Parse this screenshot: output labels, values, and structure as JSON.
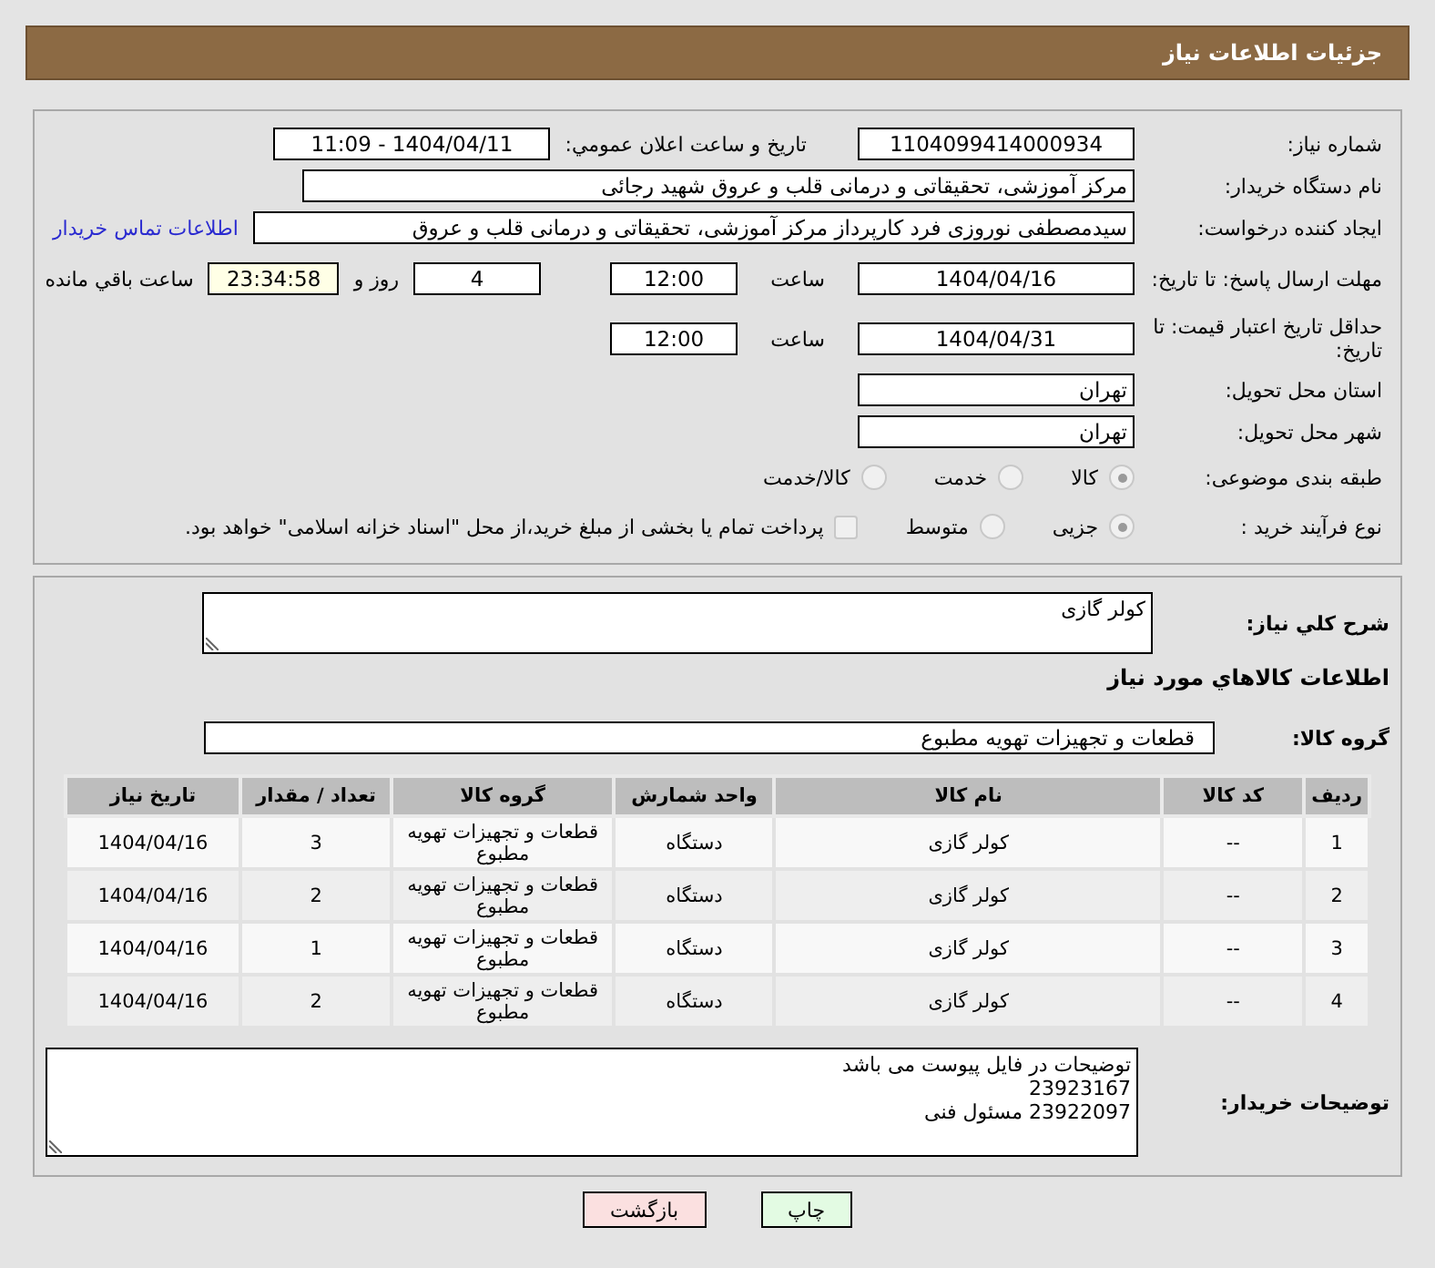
{
  "header": {
    "title": "جزئیات اطلاعات نیاز"
  },
  "need_number": {
    "label": "شماره نیاز:",
    "value": "1104099414000934"
  },
  "announce": {
    "label": "تاريخ و ساعت اعلان عمومي:",
    "value": "1404/04/11 - 11:09"
  },
  "buyer_org": {
    "label": "نام دستگاه خریدار:",
    "value": "مرکز آموزشی، تحقیقاتی و درمانی قلب و عروق شهید رجائی"
  },
  "requester": {
    "label": "ایجاد کننده درخواست:",
    "value": "سیدمصطفی نوروزی فرد کارپرداز مرکز آموزشی، تحقیقاتی و درمانی قلب و عروق",
    "link": "اطلاعات تماس خریدار"
  },
  "reply_deadline": {
    "label": "مهلت ارسال پاسخ: تا تاریخ:",
    "date": "1404/04/16",
    "time_label": "ساعت",
    "time": "12:00",
    "days": "4",
    "days_label": "روز و",
    "remaining": "23:34:58",
    "remaining_label": "ساعت باقي مانده"
  },
  "price_validity": {
    "label": "حداقل تاریخ اعتبار قیمت: تا تاریخ:",
    "date": "1404/04/31",
    "time_label": "ساعت",
    "time": "12:00"
  },
  "province": {
    "label": "استان محل تحویل:",
    "value": "تهران"
  },
  "city": {
    "label": "شهر محل تحویل:",
    "value": "تهران"
  },
  "category": {
    "label": "طبقه بندی موضوعی:",
    "options": [
      {
        "label": "كالا",
        "selected": true
      },
      {
        "label": "خدمت",
        "selected": false
      },
      {
        "label": "كالا/خدمت",
        "selected": false
      }
    ]
  },
  "process": {
    "label": "نوع فرآیند خرید :",
    "options": [
      {
        "label": "جزیی",
        "selected": true
      },
      {
        "label": "متوسط",
        "selected": false
      }
    ],
    "payment": {
      "checked": false,
      "text": "پرداخت تمام یا بخشی از مبلغ خرید،از محل \"اسناد خزانه اسلامی\" خواهد بود."
    }
  },
  "description": {
    "label": "شرح کلي نياز:",
    "value": "کولر گازی"
  },
  "goods_heading": "اطلاعات کالاهاي مورد نياز",
  "goods_group": {
    "label": "گروه کالا:",
    "value": "قطعات و تجهیزات تهویه مطبوع"
  },
  "table": {
    "columns": [
      "ردیف",
      "کد کالا",
      "نام کالا",
      "واحد شمارش",
      "گروه کالا",
      "تعداد / مقدار",
      "تاریخ نیاز"
    ],
    "rows": [
      [
        "1",
        "--",
        "کولر گازی",
        "دستگاه",
        "قطعات و تجهیزات تهویه مطبوع",
        "3",
        "1404/04/16"
      ],
      [
        "2",
        "--",
        "کولر گازی",
        "دستگاه",
        "قطعات و تجهیزات تهویه مطبوع",
        "2",
        "1404/04/16"
      ],
      [
        "3",
        "--",
        "کولر گازی",
        "دستگاه",
        "قطعات و تجهیزات تهویه مطبوع",
        "1",
        "1404/04/16"
      ],
      [
        "4",
        "--",
        "کولر گازی",
        "دستگاه",
        "قطعات و تجهیزات تهویه مطبوع",
        "2",
        "1404/04/16"
      ]
    ]
  },
  "buyer_notes": {
    "label": "توضیحات خریدار:",
    "lines": [
      "توضیحات در فایل پیوست می باشد",
      "23923167",
      "23922097 مسئول فنی"
    ]
  },
  "buttons": [
    {
      "label": "چاپ",
      "kind": "print"
    },
    {
      "label": "بازگشت",
      "kind": "back"
    }
  ]
}
